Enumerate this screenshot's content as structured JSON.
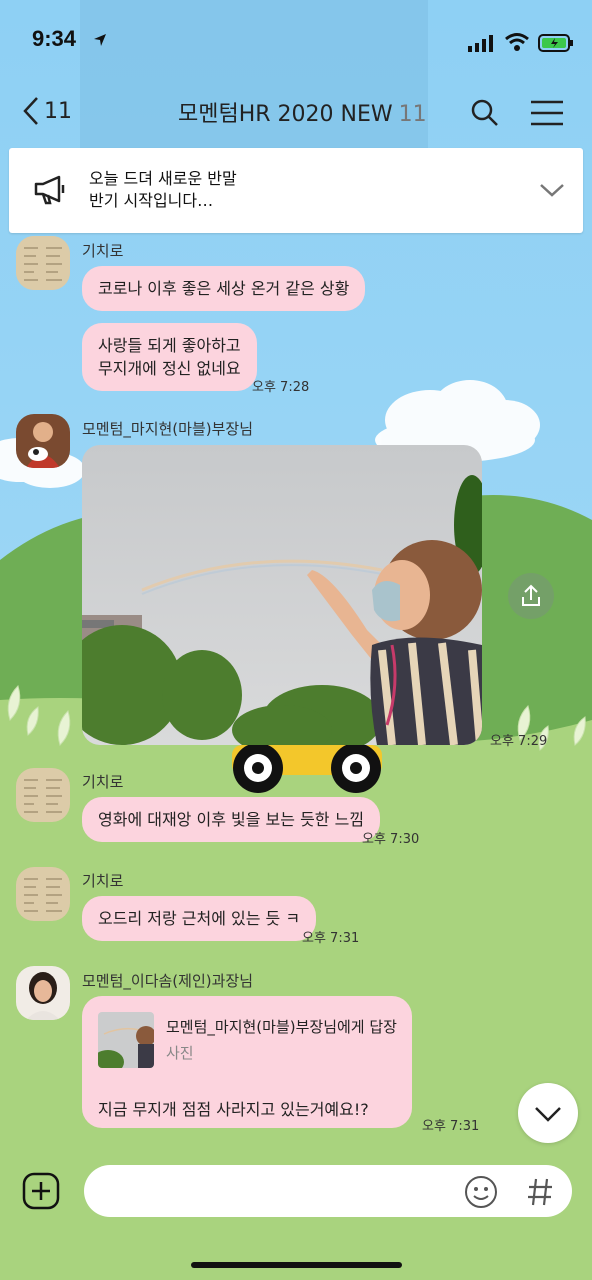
{
  "status": {
    "time": "9:34"
  },
  "header": {
    "back_count": "11",
    "title": "모멘텀HR 2020 NEW",
    "member_count": "11"
  },
  "notice": {
    "line1": "오늘 드뎌 새로운 반말",
    "line2": "반기 시작입니다…"
  },
  "messages": [
    {
      "sender": "기치로",
      "bubbles": [
        "코로나 이후 좋은 세상 온거 같은 상황",
        "사랑들 되게 좋아하고",
        "무지개에 정신 없네요"
      ],
      "time": "오후 7:28"
    },
    {
      "sender": "모멘텀_마지현(마블)부장님",
      "photo": true,
      "time": "오후 7:29"
    },
    {
      "sender": "기치로",
      "text": "영화에 대재앙 이후 빛을 보는 듯한 느낌",
      "time": "오후 7:30"
    },
    {
      "sender": "기치로",
      "text": "오드리 저랑 근처에 있는 듯 ㅋ",
      "time": "오후 7:31"
    },
    {
      "sender": "모멘텀_이다솜(제인)과장님",
      "reply_to": "모멘텀_마지현(마블)부장님에게 답장",
      "reply_type": "사진",
      "text": "지금 무지개 점점 사라지고 있는거예요!?",
      "time": "오후 7:31"
    }
  ],
  "colors": {
    "sky": "#8fcff2",
    "grass": "#a9d37e",
    "bubble": "#fcd4de"
  },
  "icons": [
    "back-chevron-icon",
    "search-icon",
    "menu-icon",
    "megaphone-icon",
    "chevron-down-icon",
    "share-icon",
    "add-icon",
    "emoji-icon",
    "hashtag-icon"
  ]
}
